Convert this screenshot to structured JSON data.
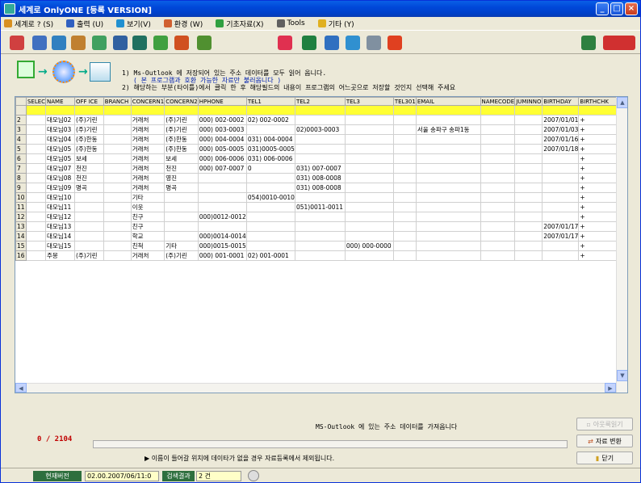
{
  "window": {
    "title": "세계로 OnlyONE [등록 VERSION]"
  },
  "menu": [
    {
      "label": "세계로 ? (S)",
      "icon": "help-icon",
      "color": "#D89020"
    },
    {
      "label": "출력 (U)",
      "icon": "printer-icon",
      "color": "#3060C0"
    },
    {
      "label": "보기(V)",
      "icon": "view-icon",
      "color": "#2090D0"
    },
    {
      "label": "환경 (W)",
      "icon": "settings-icon",
      "color": "#D06030"
    },
    {
      "label": "기초자료(X)",
      "icon": "data-icon",
      "color": "#30A040"
    },
    {
      "label": "Tools",
      "icon": "tools-icon",
      "color": "#606060"
    },
    {
      "label": "기타 (Y)",
      "icon": "star-icon",
      "color": "#E0B020"
    }
  ],
  "toolbar_icons": [
    {
      "name": "user-icon",
      "color": "#D04040"
    },
    {
      "name": "phone-icon",
      "color": "#4070C0"
    },
    {
      "name": "calendar-icon",
      "color": "#3080C0"
    },
    {
      "name": "person-card-icon",
      "color": "#C08030"
    },
    {
      "name": "edit-icon",
      "color": "#40A060"
    },
    {
      "name": "monitor-icon",
      "color": "#3060A0"
    },
    {
      "name": "document-icon",
      "color": "#207060"
    },
    {
      "name": "settings-tool-icon",
      "color": "#40A040"
    },
    {
      "name": "pie-chart-icon",
      "color": "#D05020"
    },
    {
      "name": "tree-icon",
      "color": "#509030"
    },
    {
      "name": "lifebuoy-icon",
      "color": "#E03050"
    },
    {
      "name": "excel-icon",
      "color": "#208040"
    },
    {
      "name": "folder-open-icon",
      "color": "#3070C0"
    },
    {
      "name": "search-doc-icon",
      "color": "#3090D0"
    },
    {
      "name": "blank-page-icon",
      "color": "#8090A0"
    },
    {
      "name": "email-at-icon",
      "color": "#E04020"
    },
    {
      "name": "exit-door-icon",
      "color": "#2E8040"
    },
    {
      "name": "logo-icon",
      "color": "#D03030"
    }
  ],
  "banner": {
    "line1": "1) Ms-Outlook 에 저장되어 있는 주소 데이터를 모두 읽어 옵니다.",
    "line2": "( 본 프로그램과 호환 가능한 자료만 불러옵니다 )",
    "line3": "2) 해당하는 부분(타이틀)에서 클릭 한 후 해당필드의 내용이 프로그램의 어느곳으로 저장할 것인지 선택해 주세요"
  },
  "grid": {
    "columns": [
      "SELEC",
      "NAME",
      "OFF ICE",
      "BRANCH",
      "CONCERN1",
      "CONCERN2",
      "HPHONE",
      "TEL1",
      "TEL2",
      "TEL3",
      "TEL301",
      "EMAIL",
      "NAMECODE",
      "JUMINNO",
      "BIRTHDAY",
      "BIRTHCHK"
    ],
    "rows": [
      [
        "2",
        "",
        "대모님02",
        "(주)기린",
        "",
        "거래처",
        "(주)기린",
        "000) 002-0002",
        "02) 002-0002",
        "",
        "",
        "",
        "",
        "",
        "",
        "2007/01/01",
        "+"
      ],
      [
        "3",
        "",
        "대모님03",
        "(주)기린",
        "",
        "거래처",
        "(주)기린",
        "000) 003-0003",
        "",
        "02)0003-0003",
        "",
        "",
        "서울 송파구 송파1동",
        "",
        "",
        "2007/01/03",
        "+"
      ],
      [
        "4",
        "",
        "대모님04",
        "(주)한동",
        "",
        "거래처",
        "(주)한동",
        "000) 004-0004",
        "031) 004-0004",
        "",
        "",
        "",
        "",
        "",
        "",
        "2007/01/16",
        "+"
      ],
      [
        "5",
        "",
        "대모님05",
        "(주)한동",
        "",
        "거래처",
        "(주)한동",
        "000) 005-0005",
        "031)0005-0005",
        "",
        "",
        "",
        "",
        "",
        "",
        "2007/01/18",
        "+"
      ],
      [
        "6",
        "",
        "대모님05",
        "보세",
        "",
        "거래처",
        "보세",
        "000) 006-0006",
        "031) 006-0006",
        "",
        "",
        "",
        "",
        "",
        "",
        "",
        "+"
      ],
      [
        "7",
        "",
        "대모님07",
        "천진",
        "",
        "거래처",
        "천진",
        "000) 007-0007",
        "0",
        "031) 007-0007",
        "",
        "",
        "",
        "",
        "",
        "",
        "+"
      ],
      [
        "8",
        "",
        "대모님08",
        "천진",
        "",
        "거래처",
        "영진",
        "",
        "",
        "031) 008-0008",
        "",
        "",
        "",
        "",
        "",
        "",
        "+"
      ],
      [
        "9",
        "",
        "대모님09",
        "명곡",
        "",
        "거래처",
        "명곡",
        "",
        "",
        "031) 008-0008",
        "",
        "",
        "",
        "",
        "",
        "",
        "+"
      ],
      [
        "10",
        "",
        "대모님10",
        "",
        "",
        "기타",
        "",
        "",
        "054)0010-0010",
        "",
        "",
        "",
        "",
        "",
        "",
        "",
        "+"
      ],
      [
        "11",
        "",
        "대모님11",
        "",
        "",
        "이웃",
        "",
        "",
        "",
        "051)0011-0011",
        "",
        "",
        "",
        "",
        "",
        "",
        "+"
      ],
      [
        "12",
        "",
        "대모님12",
        "",
        "",
        "친구",
        "",
        "000)0012-0012",
        "",
        "",
        "",
        "",
        "",
        "",
        "",
        "",
        "+"
      ],
      [
        "13",
        "",
        "대모님13",
        "",
        "",
        "친구",
        "",
        "",
        "",
        "",
        "",
        "",
        "",
        "",
        "",
        "2007/01/17",
        "+"
      ],
      [
        "14",
        "",
        "대모님14",
        "",
        "",
        "학교",
        "",
        "000)0014-0014",
        "",
        "",
        "",
        "",
        "",
        "",
        "",
        "2007/01/17",
        "+"
      ],
      [
        "15",
        "",
        "대모님15",
        "",
        "",
        "친척",
        "기타",
        "000)0015-0015",
        "",
        "",
        "000) 000-0000",
        "",
        "",
        "",
        "",
        "",
        "+"
      ],
      [
        "16",
        "",
        "주몽",
        "(주)기린",
        "",
        "거래처",
        "(주)기린",
        "000) 001-0001",
        "02) 001-0001",
        "",
        "",
        "",
        "",
        "",
        "",
        "",
        "+"
      ]
    ]
  },
  "status": {
    "message": "MS-Outlook 에 있는 주소 데이터를 가져옵니다",
    "counter": "0 / 2104",
    "note": "▶ 이름이 들어갈 위치에 데이타가 없을 경우 자료등록에서 제외됩니다."
  },
  "buttons": {
    "read": "아웃룩읽기",
    "convert": "자료 변환",
    "close": "닫기"
  },
  "statusbar": {
    "version_label": "현재버전",
    "version_value": "02.00.2007/06/11:0",
    "result_label": "검색결과",
    "result_value": "2 건"
  }
}
